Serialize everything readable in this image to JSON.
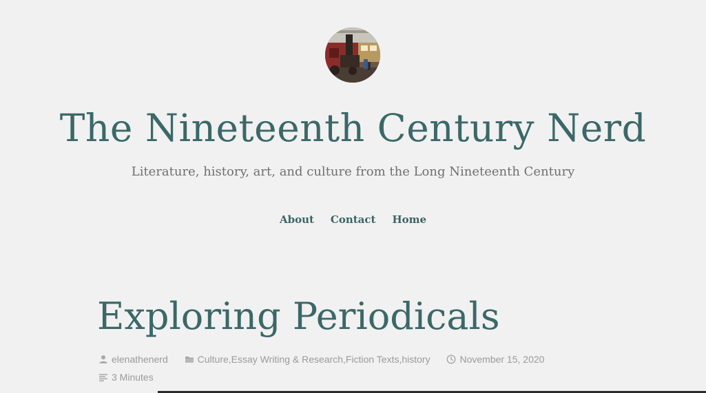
{
  "site": {
    "title": "The Nineteenth Century Nerd",
    "tagline": "Literature, history, art, and culture from the Long Nineteenth Century"
  },
  "nav": {
    "items": [
      {
        "label": "About"
      },
      {
        "label": "Contact"
      },
      {
        "label": "Home"
      }
    ]
  },
  "post": {
    "title": "Exploring Periodicals",
    "author": "elenathenerd",
    "categories": [
      "Culture",
      "Essay Writing & Research",
      "Fiction Texts",
      "history"
    ],
    "category_separator": ", ",
    "date": "November 15, 2020",
    "reading_time": "3 Minutes"
  },
  "icons": {
    "author": "person-icon",
    "categories": "folder-icon",
    "date": "clock-icon",
    "reading_time": "text-lines-icon"
  },
  "colors": {
    "background": "#f1f1f1",
    "accent": "#3b6868",
    "meta": "#9a9a9a"
  }
}
